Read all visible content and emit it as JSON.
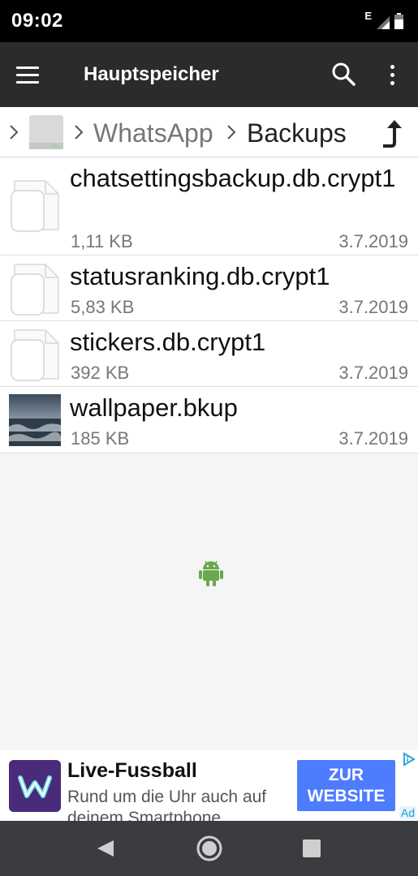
{
  "status_bar": {
    "time": "09:02",
    "network_type": "E",
    "icons": [
      "signal-icon",
      "battery-icon"
    ]
  },
  "app_bar": {
    "title": "Hauptspeicher",
    "icons": [
      "menu-icon",
      "search-icon",
      "more-vert-icon"
    ]
  },
  "breadcrumb": {
    "items": [
      "WhatsApp",
      "Backups"
    ],
    "icons": [
      "chevron-right-icon",
      "drive-icon",
      "up-arrow-icon"
    ]
  },
  "files": [
    {
      "name": "chatsettingsbackup.db.crypt1",
      "size": "1,11 KB",
      "date": "3.7.2019",
      "icon": "file-icon"
    },
    {
      "name": "statusranking.db.crypt1",
      "size": "5,83 KB",
      "date": "3.7.2019",
      "icon": "file-icon"
    },
    {
      "name": "stickers.db.crypt1",
      "size": "392 KB",
      "date": "3.7.2019",
      "icon": "file-icon"
    },
    {
      "name": "wallpaper.bkup",
      "size": "185 KB",
      "date": "3.7.2019",
      "icon": "image-thumbnail"
    }
  ],
  "empty_area": {
    "icon": "android-icon"
  },
  "ad": {
    "title": "Live-Fussball",
    "text": "Rund um die Uhr auch auf deinem Smartphone",
    "cta": "ZUR WEBSITE",
    "mark": "Ad",
    "logo_letter": "W",
    "colors": {
      "cta": "#4d7cff",
      "logo_bg": "#4a2a7a"
    }
  },
  "nav_bar": {
    "icons": [
      "back-icon",
      "home-icon",
      "recents-icon"
    ]
  },
  "colors": {
    "app_bar": "#2b2b2b",
    "status_bar": "#000000",
    "nav_bar": "#3a3c3f"
  }
}
